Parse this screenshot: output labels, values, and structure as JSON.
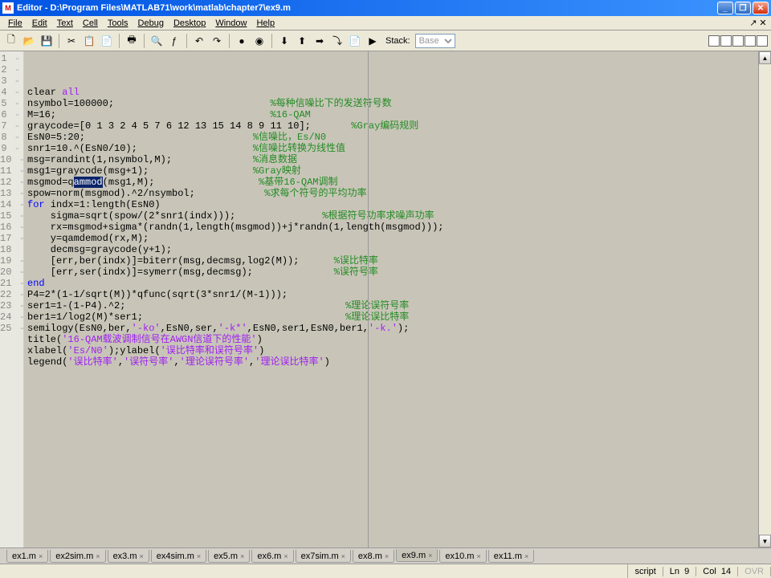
{
  "title": "Editor - D:\\Program Files\\MATLAB71\\work\\matlab\\chapter7\\ex9.m",
  "menus": [
    "File",
    "Edit",
    "Text",
    "Cell",
    "Tools",
    "Debug",
    "Desktop",
    "Window",
    "Help"
  ],
  "stack_label": "Stack:",
  "stack_value": "Base",
  "lines": [
    {
      "n": 1,
      "dash": true,
      "parts": [
        {
          "t": "clear ",
          "c": ""
        },
        {
          "t": "all",
          "c": "str"
        }
      ]
    },
    {
      "n": 2,
      "dash": true,
      "parts": [
        {
          "t": "nsymbol=100000;",
          "c": ""
        },
        {
          "t": "                           ",
          "c": ""
        },
        {
          "t": "%每种信噪比下的发送符号数",
          "c": "com"
        }
      ]
    },
    {
      "n": 3,
      "dash": true,
      "parts": [
        {
          "t": "M=16;",
          "c": ""
        },
        {
          "t": "                                     ",
          "c": ""
        },
        {
          "t": "%16-QAM",
          "c": "com"
        }
      ]
    },
    {
      "n": 4,
      "dash": true,
      "parts": [
        {
          "t": "graycode=[0 1 3 2 4 5 7 6 12 13 15 14 8 9 11 10];",
          "c": ""
        },
        {
          "t": "       ",
          "c": ""
        },
        {
          "t": "%Gray编码规则",
          "c": "com"
        }
      ]
    },
    {
      "n": 5,
      "dash": true,
      "parts": [
        {
          "t": "EsN0=5:20;",
          "c": ""
        },
        {
          "t": "                             ",
          "c": ""
        },
        {
          "t": "%信噪比，Es/N0",
          "c": "com"
        }
      ]
    },
    {
      "n": 6,
      "dash": true,
      "parts": [
        {
          "t": "snr1=10.^(EsN0/10);",
          "c": ""
        },
        {
          "t": "                    ",
          "c": ""
        },
        {
          "t": "%信噪比转换为线性值",
          "c": "com"
        }
      ]
    },
    {
      "n": 7,
      "dash": true,
      "parts": [
        {
          "t": "msg=randint(1,nsymbol,M);",
          "c": ""
        },
        {
          "t": "              ",
          "c": ""
        },
        {
          "t": "%消息数据",
          "c": "com"
        }
      ]
    },
    {
      "n": 8,
      "dash": true,
      "parts": [
        {
          "t": "msg1=graycode(msg+1);",
          "c": ""
        },
        {
          "t": "                  ",
          "c": ""
        },
        {
          "t": "%Gray映射",
          "c": "com"
        }
      ]
    },
    {
      "n": 9,
      "dash": true,
      "parts": [
        {
          "t": "msgmod=q",
          "c": ""
        },
        {
          "t": "ammod",
          "c": "sel"
        },
        {
          "t": "(msg1,M);",
          "c": ""
        },
        {
          "t": "                  ",
          "c": ""
        },
        {
          "t": "%基带16-QAM调制",
          "c": "com"
        }
      ]
    },
    {
      "n": 10,
      "dash": true,
      "parts": [
        {
          "t": "spow=norm(msgmod).^2/nsymbol;",
          "c": ""
        },
        {
          "t": "            ",
          "c": ""
        },
        {
          "t": "%求每个符号的平均功率",
          "c": "com"
        }
      ]
    },
    {
      "n": 11,
      "dash": true,
      "parts": [
        {
          "t": "for",
          "c": "kw"
        },
        {
          "t": " indx=1:length(EsN0)",
          "c": ""
        }
      ]
    },
    {
      "n": 12,
      "dash": true,
      "parts": [
        {
          "t": "    sigma=sqrt(spow/(2*snr1(indx)));",
          "c": ""
        },
        {
          "t": "               ",
          "c": ""
        },
        {
          "t": "%根据符号功率求噪声功率",
          "c": "com"
        }
      ]
    },
    {
      "n": 13,
      "dash": true,
      "parts": [
        {
          "t": "    rx=msgmod+sigma*(randn(1,length(msgmod))+j*randn(1,length(msgmod)));",
          "c": ""
        }
      ]
    },
    {
      "n": 14,
      "dash": true,
      "parts": [
        {
          "t": "    y=qamdemod(rx,M);",
          "c": ""
        }
      ]
    },
    {
      "n": 15,
      "dash": true,
      "parts": [
        {
          "t": "    decmsg=graycode(y+1);",
          "c": ""
        }
      ]
    },
    {
      "n": 16,
      "dash": true,
      "parts": [
        {
          "t": "    [err,ber(indx)]=biterr(msg,decmsg,log2(M));",
          "c": ""
        },
        {
          "t": "      ",
          "c": ""
        },
        {
          "t": "%误比特率",
          "c": "com"
        }
      ]
    },
    {
      "n": 17,
      "dash": true,
      "parts": [
        {
          "t": "    [err,ser(indx)]=symerr(msg,decmsg);",
          "c": ""
        },
        {
          "t": "              ",
          "c": ""
        },
        {
          "t": "%误符号率",
          "c": "com"
        }
      ]
    },
    {
      "n": 18,
      "dash": false,
      "parts": [
        {
          "t": "end",
          "c": "kw"
        }
      ]
    },
    {
      "n": 19,
      "dash": true,
      "parts": [
        {
          "t": "P4=2*(1-1/sqrt(M))*qfunc(sqrt(3*snr1/(M-1)));",
          "c": ""
        }
      ]
    },
    {
      "n": 20,
      "dash": true,
      "parts": [
        {
          "t": "ser1=1-(1-P4).^2;",
          "c": ""
        },
        {
          "t": "                                      ",
          "c": ""
        },
        {
          "t": "%理论误符号率",
          "c": "com"
        }
      ]
    },
    {
      "n": 21,
      "dash": true,
      "parts": [
        {
          "t": "ber1=1/log2(M)*ser1;",
          "c": ""
        },
        {
          "t": "                                   ",
          "c": ""
        },
        {
          "t": "%理论误比特率",
          "c": "com"
        }
      ]
    },
    {
      "n": 22,
      "dash": true,
      "parts": [
        {
          "t": "semilogy(EsN0,ber,",
          "c": ""
        },
        {
          "t": "'-ko'",
          "c": "str"
        },
        {
          "t": ",EsN0,ser,",
          "c": ""
        },
        {
          "t": "'-k*'",
          "c": "str"
        },
        {
          "t": ",EsN0,ser1,EsN0,ber1,",
          "c": ""
        },
        {
          "t": "'-k.'",
          "c": "str"
        },
        {
          "t": ");",
          "c": ""
        }
      ]
    },
    {
      "n": 23,
      "dash": true,
      "parts": [
        {
          "t": "title(",
          "c": ""
        },
        {
          "t": "'16-QAM载波调制信号在AWGN信道下的性能'",
          "c": "str"
        },
        {
          "t": ")",
          "c": ""
        }
      ]
    },
    {
      "n": 24,
      "dash": true,
      "parts": [
        {
          "t": "xlabel(",
          "c": ""
        },
        {
          "t": "'Es/N0'",
          "c": "str"
        },
        {
          "t": ");ylabel(",
          "c": ""
        },
        {
          "t": "'误比特率和误符号率'",
          "c": "str"
        },
        {
          "t": ")",
          "c": ""
        }
      ]
    },
    {
      "n": 25,
      "dash": true,
      "parts": [
        {
          "t": "legend(",
          "c": ""
        },
        {
          "t": "'误比特率'",
          "c": "str"
        },
        {
          "t": ",",
          "c": ""
        },
        {
          "t": "'误符号率'",
          "c": "str"
        },
        {
          "t": ",",
          "c": ""
        },
        {
          "t": "'理论误符号率'",
          "c": "str"
        },
        {
          "t": ",",
          "c": ""
        },
        {
          "t": "'理论误比特率'",
          "c": "str"
        },
        {
          "t": ")",
          "c": ""
        }
      ]
    }
  ],
  "tabs": [
    "ex1.m",
    "ex2sim.m",
    "ex3.m",
    "ex4sim.m",
    "ex5.m",
    "ex6.m",
    "ex7sim.m",
    "ex8.m",
    "ex9.m",
    "ex10.m",
    "ex11.m"
  ],
  "active_tab": "ex9.m",
  "status": {
    "mode": "script",
    "ln_label": "Ln",
    "ln": "9",
    "col_label": "Col",
    "col": "14",
    "ovr": "OVR"
  },
  "toolbar_icons": {
    "new": "🗋",
    "open": "📂",
    "save": "💾",
    "cut": "✂",
    "copy": "📋",
    "paste": "📄",
    "print": "🖶",
    "find": "🔍",
    "fx": "ƒ",
    "undo": "↶",
    "redo": "↷",
    "bp1": "●",
    "bp2": "◉",
    "step1": "⬇",
    "step2": "⬆",
    "step3": "➡",
    "step4": "⤵",
    "run1": "📄",
    "run2": "▶"
  }
}
